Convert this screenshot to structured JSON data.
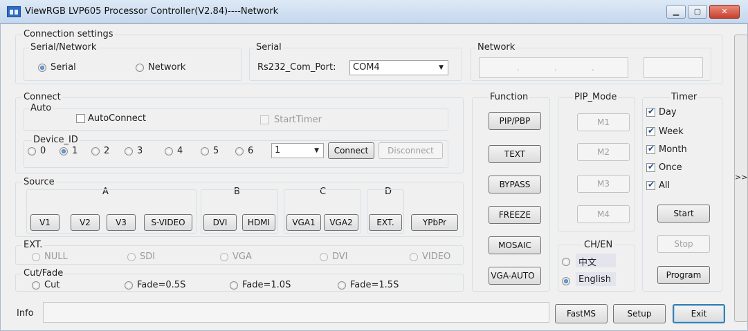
{
  "window": {
    "title": "ViewRGB LVP605 Processor Controller(V2.84)----Network",
    "minimize": "▁",
    "maximize": "▢",
    "close": "✕"
  },
  "connection_settings": {
    "label": "Connection settings",
    "serial_network": {
      "label": "Serial/Network",
      "serial": "Serial",
      "network": "Network",
      "selected": "Serial"
    },
    "serial": {
      "label": "Serial",
      "port_label": "Rs232_Com_Port:",
      "port_value": "COM4"
    },
    "network": {
      "label": "Network",
      "ip_separators": [
        ".",
        ".",
        "."
      ]
    }
  },
  "connect": {
    "label": "Connect",
    "auto": {
      "label": "Auto",
      "autoconnect": "AutoConnect",
      "starttimer": "StartTimer"
    },
    "device_id": {
      "label": "Device_ID",
      "options": [
        "0",
        "1",
        "2",
        "3",
        "4",
        "5",
        "6"
      ],
      "selected": "1",
      "combo_value": "1"
    },
    "connect_button": "Connect",
    "disconnect_button": "Disconnect"
  },
  "source": {
    "label": "Source",
    "groups": {
      "a": "A",
      "b": "B",
      "c": "C",
      "d": "D"
    },
    "buttons": {
      "v1": "V1",
      "v2": "V2",
      "v3": "V3",
      "svideo": "S-VIDEO",
      "dvi": "DVI",
      "hdmi": "HDMI",
      "vga1": "VGA1",
      "vga2": "VGA2",
      "ext": "EXT.",
      "ypbpr": "YPbPr"
    }
  },
  "ext": {
    "label": "EXT.",
    "options": [
      "NULL",
      "SDI",
      "VGA",
      "DVI",
      "VIDEO"
    ]
  },
  "cutfade": {
    "label": "Cut/Fade",
    "options": [
      "Cut",
      "Fade=0.5S",
      "Fade=1.0S",
      "Fade=1.5S"
    ]
  },
  "function": {
    "label": "Function",
    "buttons": [
      "PIP/PBP",
      "TEXT",
      "BYPASS",
      "FREEZE",
      "MOSAIC",
      "VGA-AUTO"
    ]
  },
  "pip_mode": {
    "label": "PIP_Mode",
    "buttons": [
      "M1",
      "M2",
      "M3",
      "M4"
    ]
  },
  "chen": {
    "label": "CH/EN",
    "chinese": "中文",
    "english": "English",
    "selected": "English"
  },
  "timer": {
    "label": "Timer",
    "checks": [
      "Day",
      "Week",
      "Month",
      "Once",
      "All"
    ],
    "start": "Start",
    "stop": "Stop",
    "program": "Program"
  },
  "expand": ">>",
  "info": {
    "label": "Info",
    "value": ""
  },
  "bottom_buttons": {
    "fastms": "FastMS",
    "setup": "Setup",
    "exit": "Exit"
  }
}
